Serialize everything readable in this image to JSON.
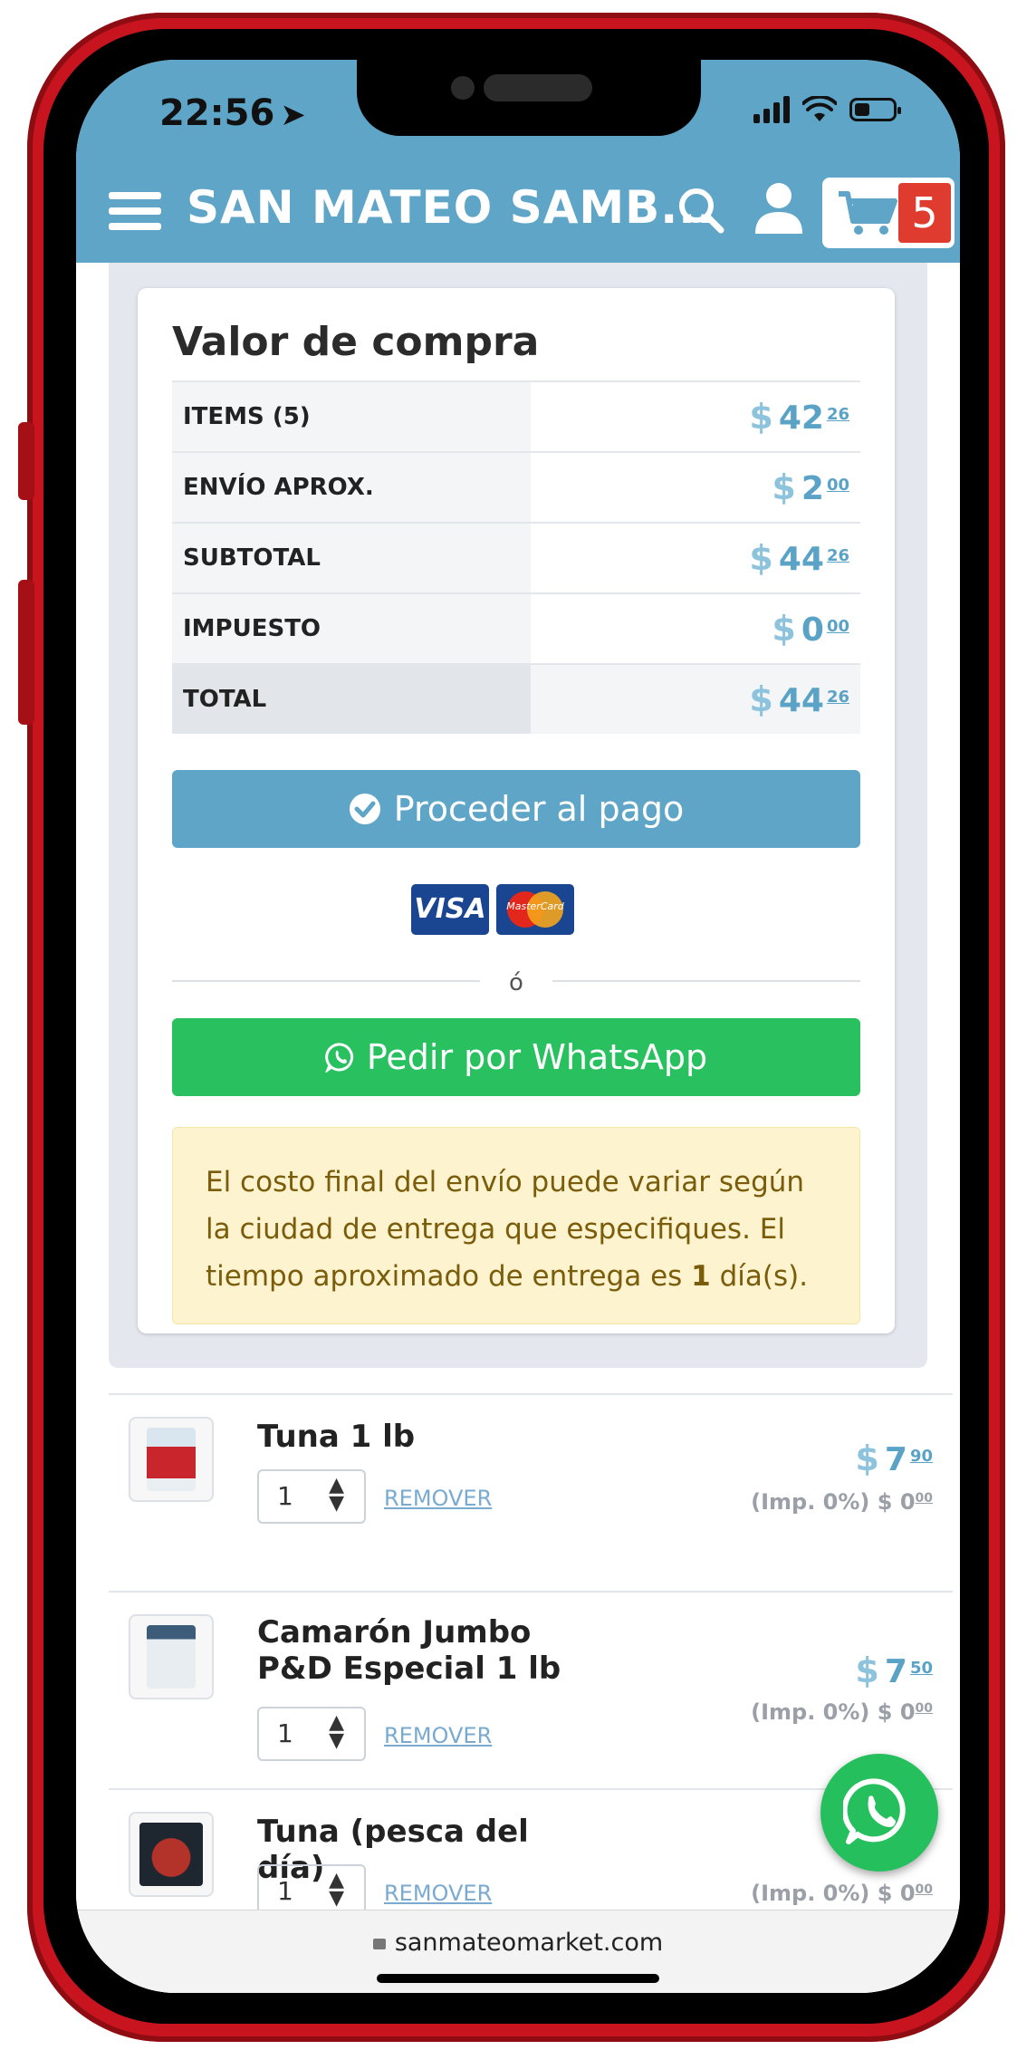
{
  "status": {
    "time": "22:56"
  },
  "header": {
    "brand": "SAN MATEO SAMB...",
    "cart_count": "5"
  },
  "summary": {
    "title": "Valor de compra",
    "rows": [
      {
        "label": "ITEMS (5)",
        "symbol": "$",
        "amount": "42",
        "cents": "26"
      },
      {
        "label": "ENVÍO APROX.",
        "symbol": "$",
        "amount": "2",
        "cents": "00"
      },
      {
        "label": "SUBTOTAL",
        "symbol": "$",
        "amount": "44",
        "cents": "26"
      },
      {
        "label": "IMPUESTO",
        "symbol": "$",
        "amount": "0",
        "cents": "00"
      },
      {
        "label": "TOTAL",
        "symbol": "$",
        "amount": "44",
        "cents": "26"
      }
    ],
    "pay_button": "Proceder al pago",
    "visa": "VISA",
    "mastercard": "MasterCard",
    "or": "ó",
    "whatsapp_button": "Pedir por WhatsApp",
    "note_prefix": "El costo final del envío puede variar según la ciudad de entrega que especifiques. El tiempo aproximado de entrega es ",
    "note_days": "1",
    "note_suffix": " día(s)."
  },
  "items": [
    {
      "name": "Tuna 1 lb",
      "qty": "1",
      "remove": "REMOVER",
      "symbol": "$",
      "amount": "7",
      "cents": "90",
      "tax_label": "(Imp. 0%)",
      "tax_symbol": "$",
      "tax_amount": "0",
      "tax_cents": "00"
    },
    {
      "name": "Camarón Jumbo P&D Especial 1 lb",
      "qty": "1",
      "remove": "REMOVER",
      "symbol": "$",
      "amount": "7",
      "cents": "50",
      "tax_label": "(Imp. 0%)",
      "tax_symbol": "$",
      "tax_amount": "0",
      "tax_cents": "00"
    },
    {
      "name": "Tuna (pesca del día)",
      "qty": "1",
      "remove": "REMOVER",
      "tax_label": "(Imp. 0%)",
      "tax_symbol": "$",
      "tax_amount": "0",
      "tax_cents": "00"
    }
  ],
  "browser": {
    "url": "sanmateomarket.com"
  },
  "colors": {
    "primary": "#5ea5c8",
    "whatsapp": "#29c160",
    "cart_badge": "#e03b2f",
    "frame": "#c8141e"
  }
}
